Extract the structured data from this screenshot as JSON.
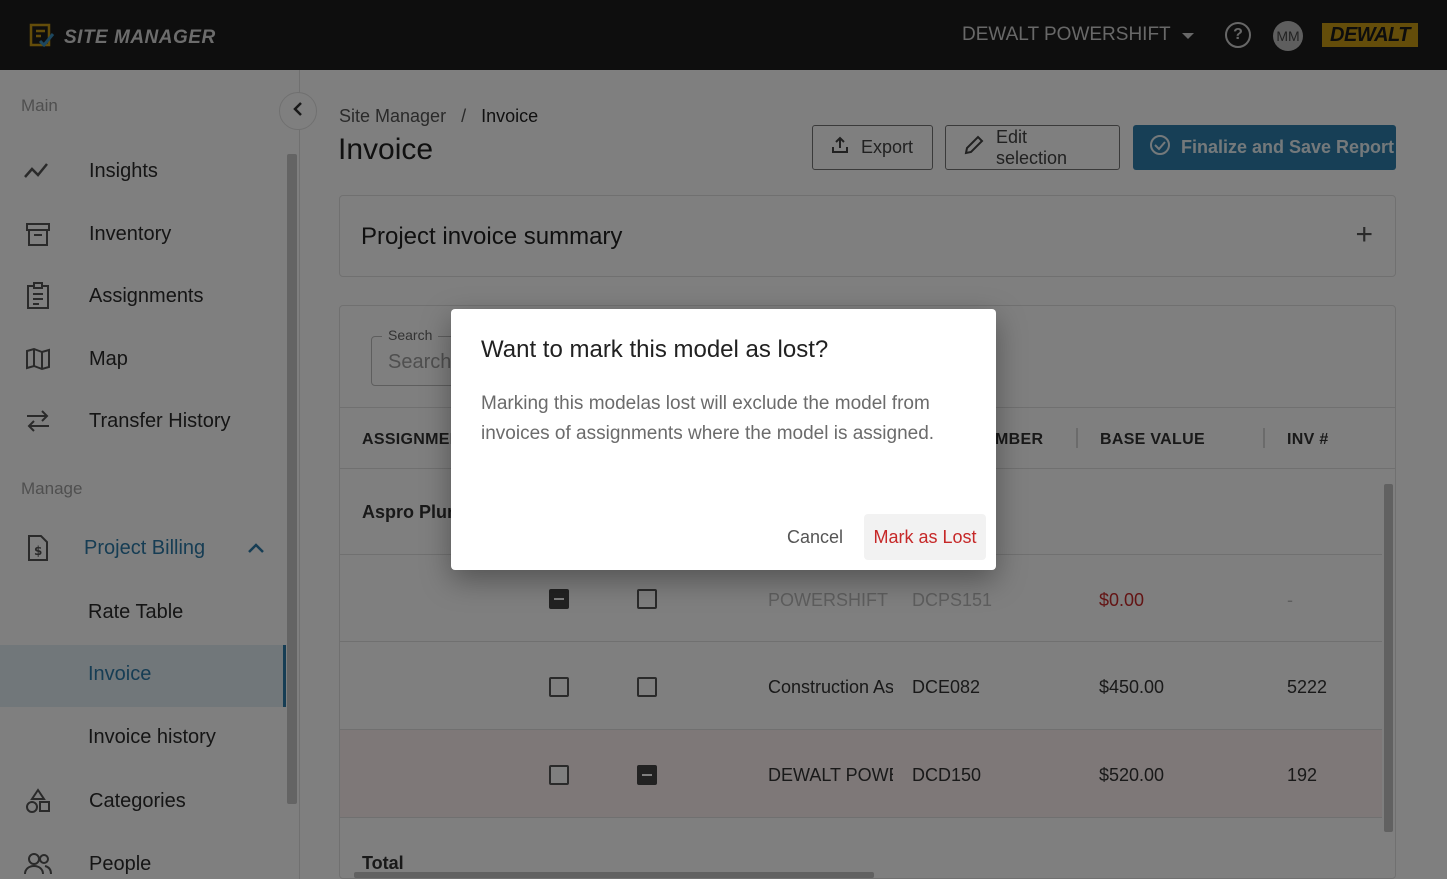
{
  "topbar": {
    "app_name": "SITE MANAGER",
    "org_name": "DEWALT POWERSHIFT",
    "help_symbol": "?",
    "avatar_initials": "MM",
    "brand": "DEWALT"
  },
  "sidebar": {
    "main_label": "Main",
    "manage_label": "Manage",
    "items": [
      {
        "label": "Insights",
        "icon": "trend-line-icon"
      },
      {
        "label": "Inventory",
        "icon": "archive-box-icon"
      },
      {
        "label": "Assignments",
        "icon": "clipboard-icon"
      },
      {
        "label": "Map",
        "icon": "map-icon"
      },
      {
        "label": "Transfer History",
        "icon": "transfer-arrows-icon"
      }
    ],
    "billing": {
      "label": "Project Billing",
      "icon": "invoice-dollar-icon",
      "sub": [
        {
          "label": "Rate Table"
        },
        {
          "label": "Invoice"
        },
        {
          "label": "Invoice history"
        }
      ]
    },
    "categories": {
      "label": "Categories",
      "icon": "shapes-icon"
    },
    "people": {
      "label": "People",
      "icon": "people-icon"
    }
  },
  "main": {
    "breadcrumb_root": "Site Manager",
    "breadcrumb_sep": "/",
    "breadcrumb_current": "Invoice",
    "title": "Invoice",
    "export_label": "Export",
    "edit_label": "Edit selection",
    "finalize_label": "Finalize and Save Report",
    "summary_title": "Project invoice summary",
    "summary_expand": "+",
    "search_label": "Search",
    "search_placeholder": "Search",
    "columns": {
      "assignment": "ASSIGNMEN",
      "number": "MBER",
      "base_value": "BASE VALUE",
      "inv": "INV #"
    },
    "group_name": "Aspro Plun",
    "rows": [
      {
        "name": "POWERSHIFT CC",
        "model": "DCPS151",
        "base_value": "$0.00",
        "inv": "-"
      },
      {
        "name": "Construction As",
        "model": "DCE082",
        "base_value": "$450.00",
        "inv": "5222"
      },
      {
        "name": "DEWALT POWEF",
        "model": "DCD150",
        "base_value": "$520.00",
        "inv": "192"
      }
    ],
    "total_label": "Total"
  },
  "dialog": {
    "title": "Want to mark this model as lost?",
    "body": "Marking this modelas lost will exclude the model from invoices of assignments where the model is assigned.",
    "cancel_label": "Cancel",
    "confirm_label": "Mark as Lost"
  }
}
